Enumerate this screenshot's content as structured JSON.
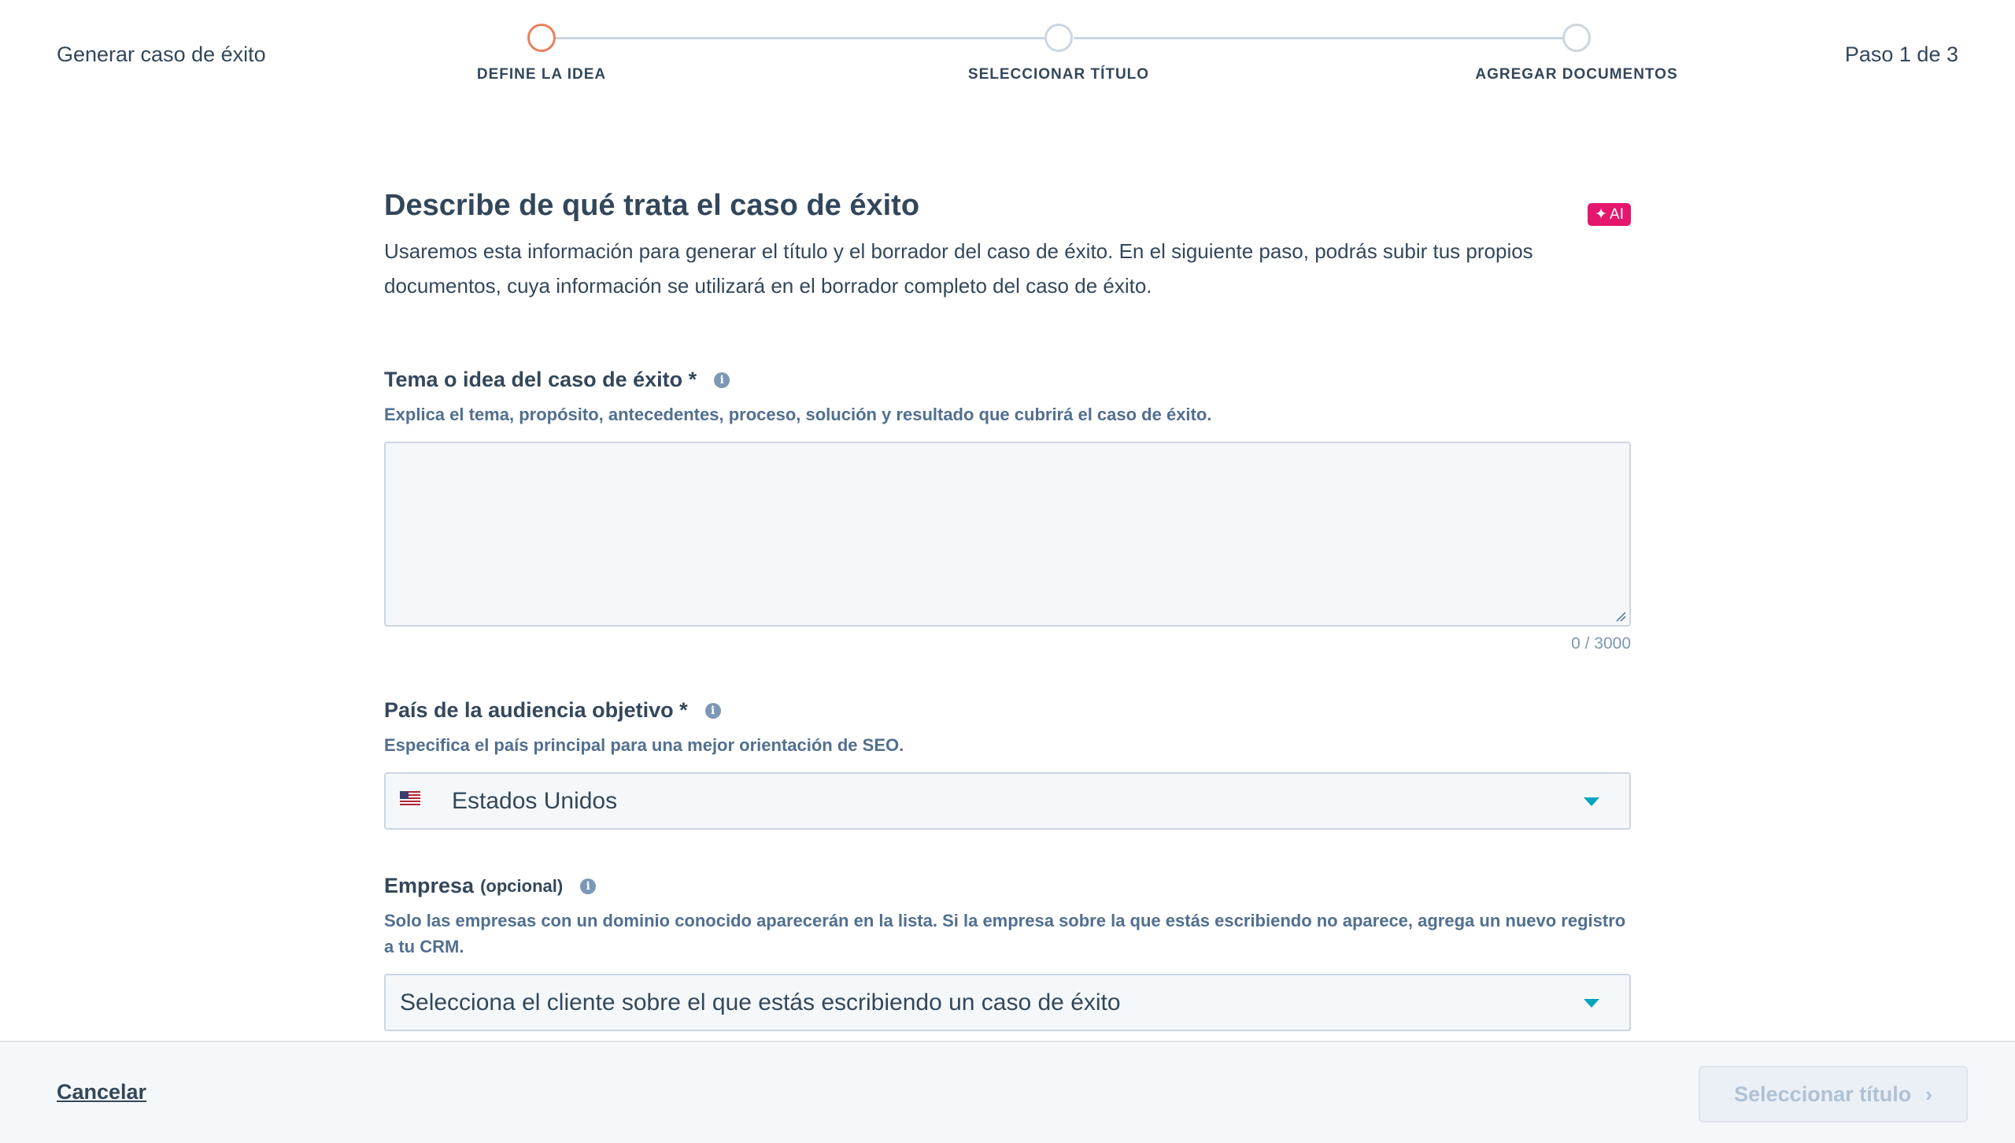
{
  "header": {
    "title": "Generar caso de éxito",
    "step_count": "Paso 1 de 3",
    "steps": [
      {
        "label": "DEFINE LA IDEA",
        "state": "active"
      },
      {
        "label": "SELECCIONAR TÍTULO",
        "state": "upcoming"
      },
      {
        "label": "AGREGAR DOCUMENTOS",
        "state": "upcoming"
      }
    ]
  },
  "main": {
    "title": "Describe de qué trata el caso de éxito",
    "ai_badge": "AI",
    "intro": "Usaremos esta información para generar el título y el borrador del caso de éxito. En el siguiente paso, podrás subir tus propios documentos, cuya información se utilizará en el borrador completo del caso de éxito.",
    "topic": {
      "label": "Tema o idea del caso de éxito *",
      "help": "Explica el tema, propósito, antecedentes, proceso, solución y resultado que cubrirá el caso de éxito.",
      "value": "",
      "char_count": "0 / 3000"
    },
    "country": {
      "label": "País de la audiencia objetivo *",
      "help": "Especifica el país principal para una mejor orientación de SEO.",
      "value": "Estados Unidos",
      "flag_icon": "us-flag-icon"
    },
    "company": {
      "label": "Empresa",
      "optional": "(opcional)",
      "help": "Solo las empresas con un dominio conocido aparecerán en la lista. Si la empresa sobre la que estás escribiendo no aparece, agrega un nuevo registro a tu CRM.",
      "placeholder": "Selecciona el cliente sobre el que estás escribiendo un caso de éxito"
    }
  },
  "footer": {
    "cancel": "Cancelar",
    "next": "Seleccionar título"
  },
  "colors": {
    "active_step": "#e8805f",
    "ai_badge": "#e5166d",
    "caret": "#00a4bd",
    "text": "#33475b"
  }
}
